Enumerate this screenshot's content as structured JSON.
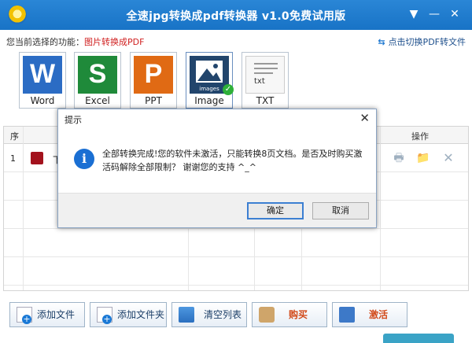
{
  "window": {
    "title": "全速jpg转换成pdf转换器 v1.0免费试用版",
    "menu_glyph": "▼",
    "minimize_glyph": "—",
    "close_glyph": "✕"
  },
  "function_bar": {
    "label": "您当前选择的功能：",
    "current": "图片转换成PDF",
    "switch_link": "点击切换PDF转文件",
    "switch_arrows": "⇆"
  },
  "formats": [
    {
      "label": "Word",
      "glyph": "W"
    },
    {
      "label": "Excel",
      "glyph": "S"
    },
    {
      "label": "PPT",
      "glyph": "P"
    },
    {
      "label": "Image",
      "glyph": "images",
      "selected": true
    },
    {
      "label": "TXT",
      "glyph": "txt"
    }
  ],
  "table": {
    "headers": {
      "index": "序",
      "actions": "操作"
    },
    "rows": [
      {
        "index": "1",
        "name": "下"
      }
    ],
    "action_glyphs": {
      "print": "🖶",
      "folder": "📁",
      "delete": "✕"
    }
  },
  "bottom_buttons": {
    "add_file": "添加文件",
    "add_folder": "添加文件夹",
    "clear_list": "清空列表",
    "buy": "购买",
    "activate": "激活"
  },
  "dialog": {
    "title": "提示",
    "close_glyph": "✕",
    "icon_glyph": "i",
    "message": "全部转换完成!您的软件未激活，只能转换8页文档。是否及时购买激活码解除全部限制？ 谢谢您的支持 ^_^",
    "ok": "确定",
    "cancel": "取消"
  },
  "colors": {
    "titlebar": "#1873c6",
    "current_function": "#d02020",
    "link": "#1d4f8c"
  }
}
